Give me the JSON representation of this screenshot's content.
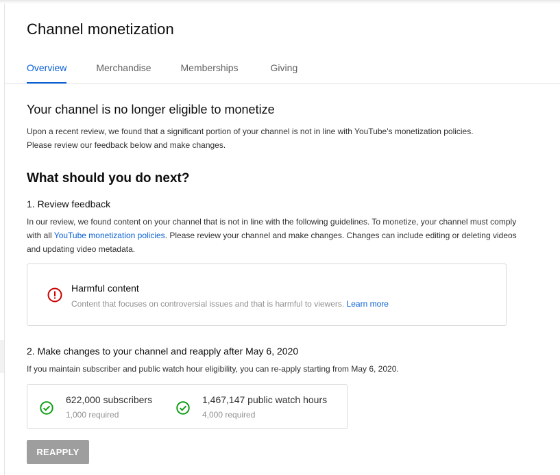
{
  "page": {
    "title": "Channel monetization"
  },
  "tabs": [
    {
      "label": "Overview",
      "active": true
    },
    {
      "label": "Merchandise",
      "active": false
    },
    {
      "label": "Memberships",
      "active": false
    },
    {
      "label": "Giving",
      "active": false
    }
  ],
  "status": {
    "heading": "Your channel is no longer eligible to monetize",
    "description": "Upon a recent review, we found that a significant portion of your channel is not in line with YouTube's monetization policies. Please review our feedback below and make changes."
  },
  "next_steps": {
    "heading": "What should you do next?",
    "step1": {
      "title": "1. Review feedback",
      "text_before_link": "In our review, we found content on your channel that is not in line with the following guidelines. To monetize, your channel must comply with all ",
      "link": "YouTube monetization policies",
      "text_after_link": ". Please review your channel and make changes. Changes can include editing or deleting videos and updating video metadata."
    },
    "feedback_card": {
      "icon": "error-icon",
      "title": "Harmful content",
      "description": "Content that focuses on controversial issues and that is harmful to viewers.",
      "link": "Learn more"
    },
    "step2": {
      "title": "2. Make changes to your channel and reapply after May 6, 2020",
      "text": "If you maintain subscriber and public watch hour eligibility, you can re-apply starting from May 6, 2020."
    }
  },
  "stats": [
    {
      "icon": "check-circle-icon",
      "value": "622,000 subscribers",
      "requirement": "1,000 required"
    },
    {
      "icon": "check-circle-icon",
      "value": "1,467,147 public watch hours",
      "requirement": "4,000 required"
    }
  ],
  "actions": {
    "reapply_label": "REAPPLY"
  },
  "colors": {
    "accent": "#065fd4",
    "error": "#cc0000",
    "success": "#0f9d15",
    "button_disabled": "#9e9e9e"
  }
}
